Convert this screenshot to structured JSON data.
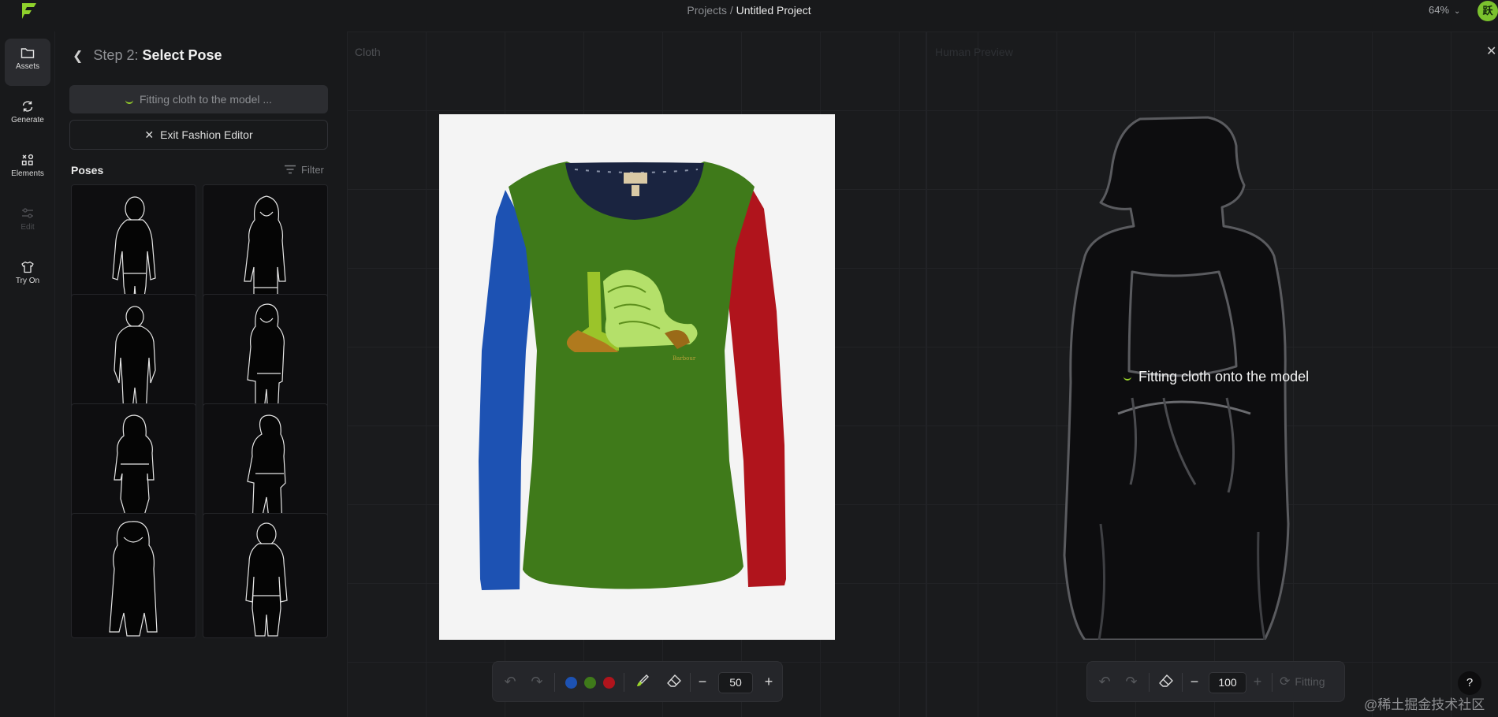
{
  "topbar": {
    "breadcrumb_parent": "Projects",
    "breadcrumb_sep": "/",
    "project_name": "Untitled Project",
    "zoom_level": "64%",
    "avatar_text": "跃"
  },
  "nav": {
    "items": [
      {
        "label": "Assets",
        "icon": "folder-icon",
        "active": true,
        "disabled": false
      },
      {
        "label": "Generate",
        "icon": "refresh-icon",
        "active": false,
        "disabled": false
      },
      {
        "label": "Elements",
        "icon": "elements-icon",
        "active": false,
        "disabled": false
      },
      {
        "label": "Edit",
        "icon": "sliders-icon",
        "active": false,
        "disabled": true
      },
      {
        "label": "Try On",
        "icon": "tshirt-icon",
        "active": false,
        "disabled": false
      }
    ]
  },
  "panel": {
    "step_prefix": "Step 2:",
    "step_title": "Select Pose",
    "fitting_button": "Fitting cloth to the model ...",
    "exit_button": "Exit Fashion Editor",
    "poses_title": "Poses",
    "filter_label": "Filter",
    "pose_count_visible": 8
  },
  "canvas": {
    "cloth_label": "Cloth",
    "preview_label": "Human Preview",
    "fitting_message": "Fitting cloth onto the model",
    "cloth_colors": [
      "#1d52b3",
      "#3f7a1a",
      "#b0141c"
    ]
  },
  "toolbar_left": {
    "brush_size": "50"
  },
  "toolbar_right": {
    "brush_size": "100",
    "fitting_label": "Fitting"
  },
  "help_label": "?",
  "watermark": "@稀土掘金技术社区"
}
